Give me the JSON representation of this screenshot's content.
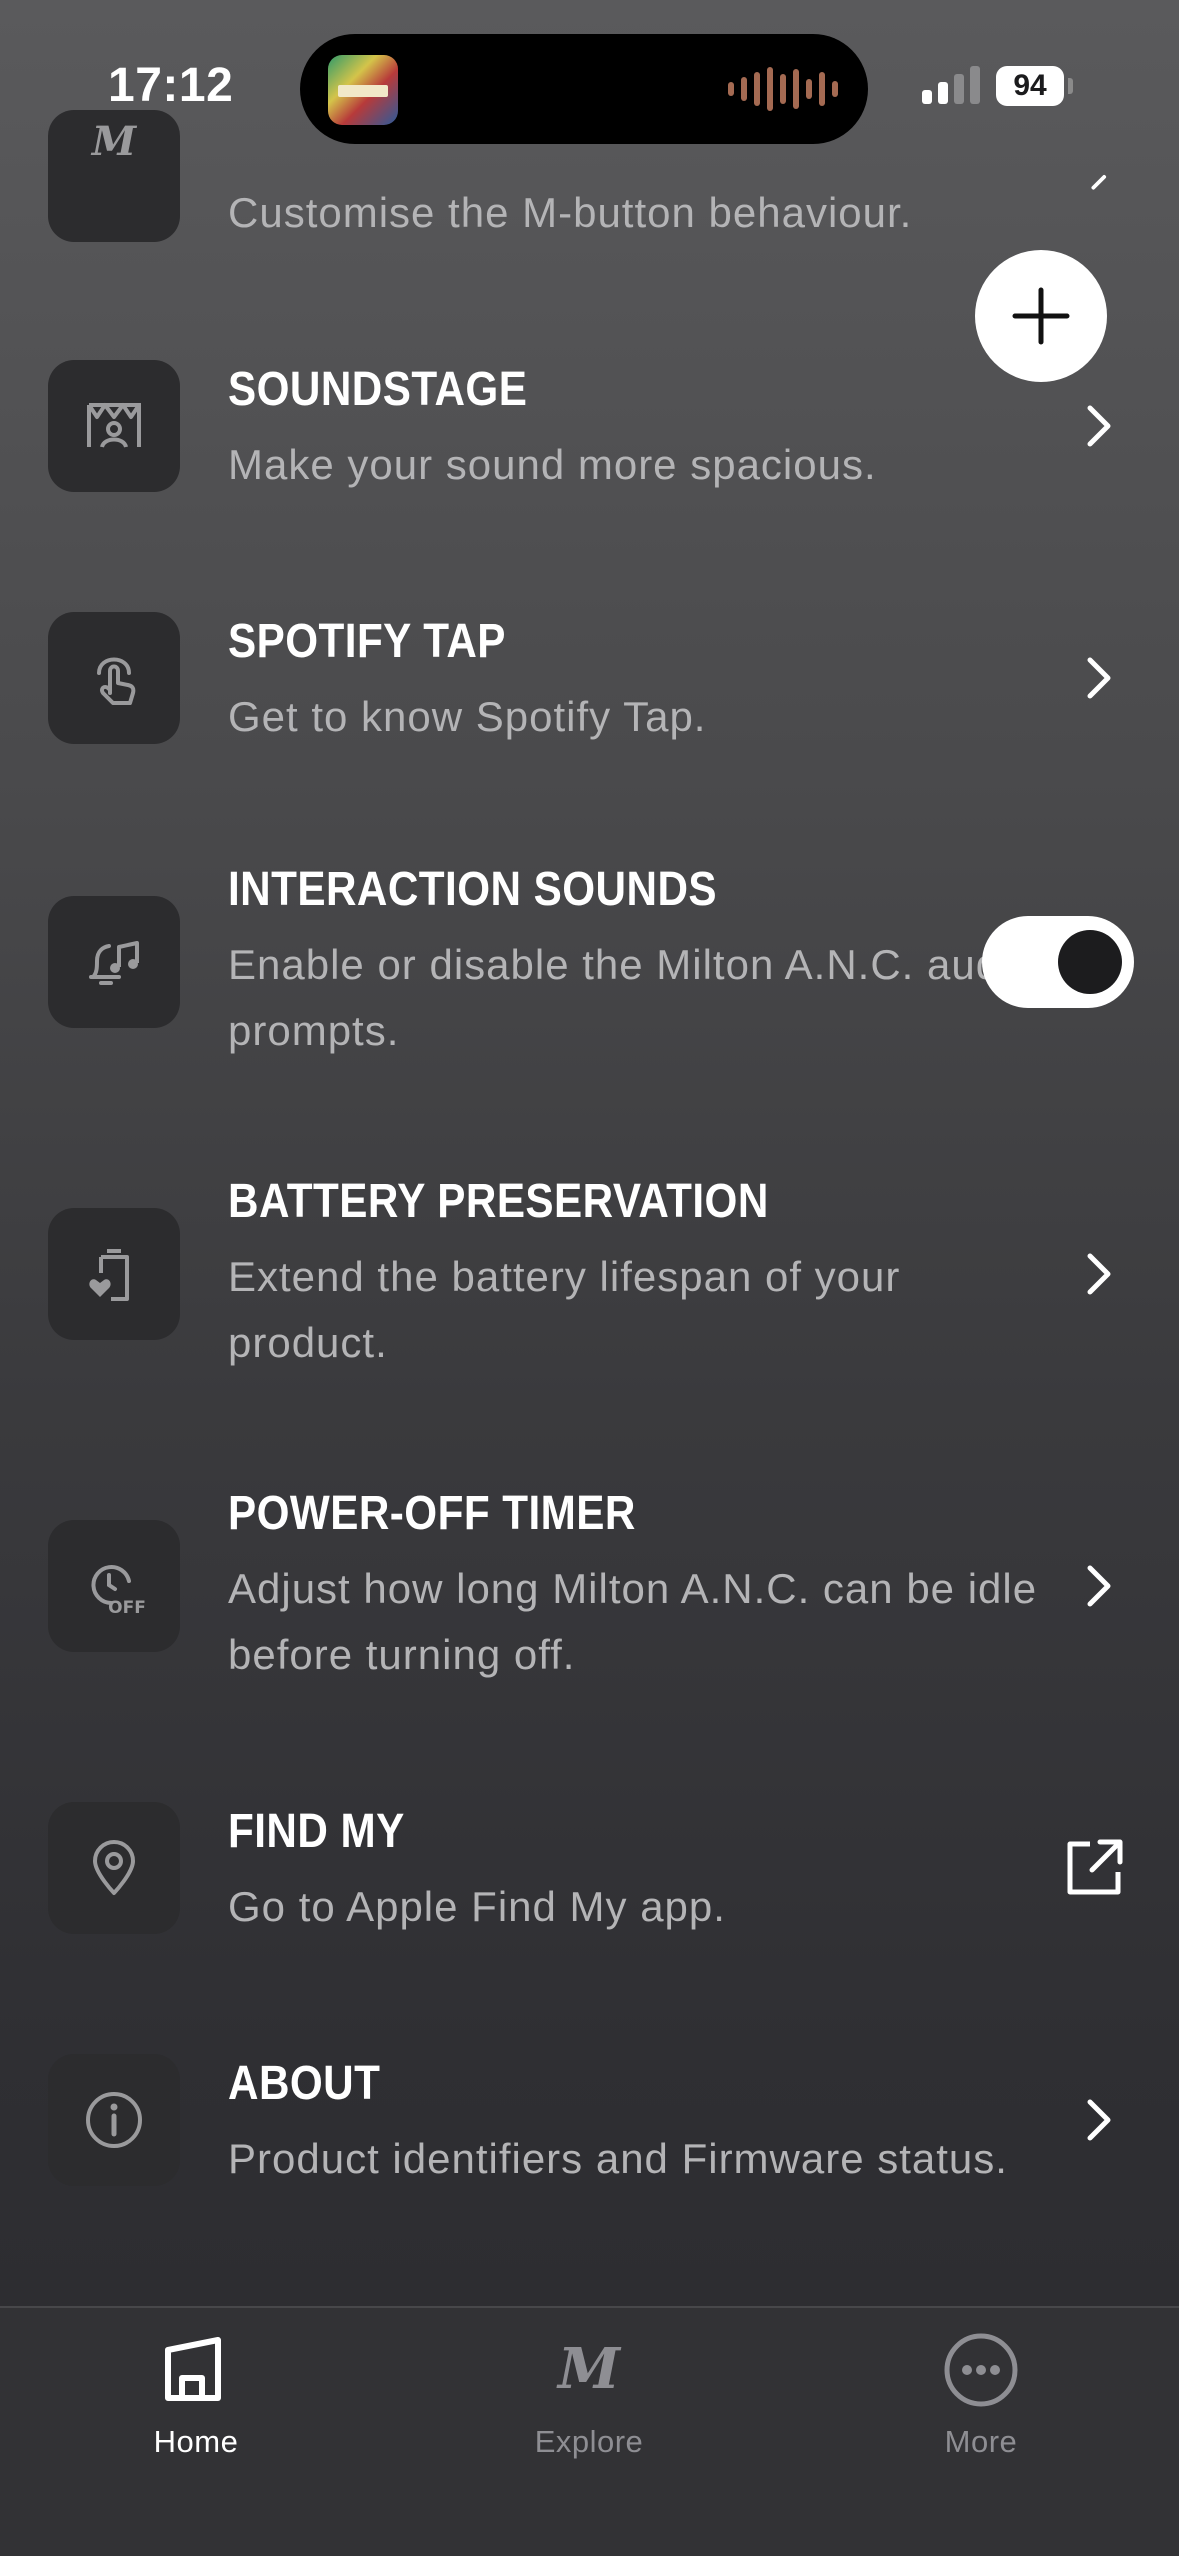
{
  "status_bar": {
    "time": "17:12",
    "battery": "94"
  },
  "settings": [
    {
      "title": "",
      "description": "Customise the M-button behaviour.",
      "icon": "m-button-icon",
      "action": "chevron"
    },
    {
      "title": "SOUNDSTAGE",
      "description": "Make your sound more spacious.",
      "icon": "soundstage-icon",
      "action": "chevron"
    },
    {
      "title": "SPOTIFY TAP",
      "description": "Get to know Spotify Tap.",
      "icon": "tap-gesture-icon",
      "action": "chevron"
    },
    {
      "title": "INTERACTION SOUNDS",
      "description": "Enable or disable the Milton A.N.C. audio prompts.",
      "icon": "notification-sound-icon",
      "action": "toggle",
      "toggle_on": true
    },
    {
      "title": "BATTERY PRESERVATION",
      "description": "Extend the battery lifespan of your product.",
      "icon": "battery-heart-icon",
      "action": "chevron"
    },
    {
      "title": "POWER-OFF TIMER",
      "description": "Adjust how long Milton A.N.C. can be idle before turning off.",
      "icon": "timer-off-icon",
      "action": "chevron"
    },
    {
      "title": "FIND MY",
      "description": "Go to Apple Find My app.",
      "icon": "location-pin-icon",
      "action": "external-link"
    },
    {
      "title": "ABOUT",
      "description": "Product identifiers and Firmware status.",
      "icon": "info-icon",
      "action": "chevron"
    }
  ],
  "tab_bar": {
    "tabs": [
      {
        "label": "Home",
        "icon": "home-icon",
        "active": true
      },
      {
        "label": "Explore",
        "icon": "marshall-m-icon",
        "active": false
      },
      {
        "label": "More",
        "icon": "more-icon",
        "active": false
      }
    ]
  },
  "colors": {
    "background_top": "#5a5a5c",
    "background_bottom": "#2b2b2f",
    "icon_tile": "#2c2c2e",
    "description_text": "#b4b4b6",
    "tab_active": "#ffffff",
    "tab_inactive": "#8e8e93"
  }
}
